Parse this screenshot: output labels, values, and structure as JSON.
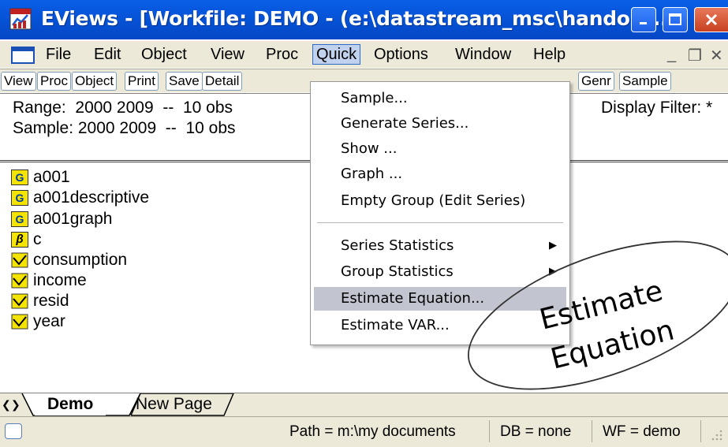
{
  "window": {
    "title": "EViews - [Workfile: DEMO - (e:\\datastream_msc\\handout..."
  },
  "menubar": {
    "items": [
      "File",
      "Edit",
      "Object",
      "View",
      "Proc",
      "Quick",
      "Options",
      "Window",
      "Help"
    ],
    "active": "Quick"
  },
  "toolbar": {
    "buttons": [
      "View",
      "Proc",
      "Object",
      "Print",
      "Save",
      "Detail",
      "Genr",
      "Sample"
    ]
  },
  "info": {
    "range": "Range:  2000 2009  --  10 obs",
    "sample": "Sample: 2000 2009  --  10 obs",
    "display_filter": "Display Filter: *"
  },
  "objects": [
    {
      "name": "a001",
      "icon": "group-icon",
      "glyph": "G"
    },
    {
      "name": "a001descriptive",
      "icon": "group-icon",
      "glyph": "G"
    },
    {
      "name": "a001graph",
      "icon": "group-icon",
      "glyph": "G"
    },
    {
      "name": "c",
      "icon": "coefficient-icon",
      "glyph": "β"
    },
    {
      "name": "consumption",
      "icon": "series-icon",
      "glyph": ""
    },
    {
      "name": "income",
      "icon": "series-icon",
      "glyph": ""
    },
    {
      "name": "resid",
      "icon": "series-icon",
      "glyph": ""
    },
    {
      "name": "year",
      "icon": "series-icon",
      "glyph": ""
    }
  ],
  "tabs": {
    "items": [
      "Demo",
      "New Page"
    ],
    "active": "Demo"
  },
  "status": {
    "path": "Path = m:\\my documents",
    "db": "DB = none",
    "wf": "WF = demo"
  },
  "quick_menu": {
    "items": [
      {
        "label": "Sample...",
        "submenu": false
      },
      {
        "label": "Generate Series...",
        "submenu": false
      },
      {
        "label": "Show ...",
        "submenu": false
      },
      {
        "label": "Graph ...",
        "submenu": false
      },
      {
        "label": "Empty Group (Edit Series)",
        "submenu": false
      },
      {
        "label": "Series Statistics",
        "submenu": true
      },
      {
        "label": "Group Statistics",
        "submenu": true
      },
      {
        "label": "Estimate Equation...",
        "submenu": false,
        "highlighted": true
      },
      {
        "label": "Estimate VAR...",
        "submenu": false
      }
    ]
  },
  "annotation": {
    "line1": "Estimate",
    "line2": "Equation"
  },
  "colors": {
    "titlebar": "#0654d8",
    "menu_highlight": "#c2c5d0",
    "chrome": "#ece9d8",
    "icon_yellow": "#f5e400"
  }
}
